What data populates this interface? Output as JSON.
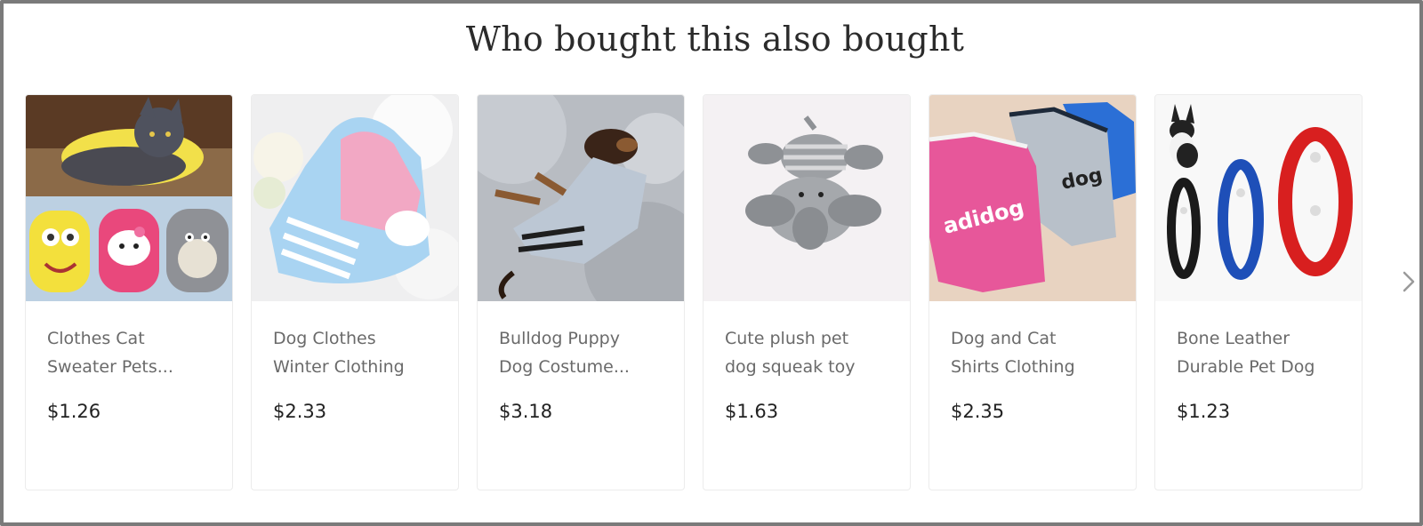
{
  "section": {
    "title": "Who bought this also bought"
  },
  "products": [
    {
      "name_line1": "Clothes Cat",
      "name_line2": "Sweater Pets...",
      "price": "$1.26",
      "image": "cat-sweater-photo"
    },
    {
      "name_line1": "Dog Clothes",
      "name_line2": "Winter Clothing",
      "price": "$2.33",
      "image": "pink-blue-hoodie-photo"
    },
    {
      "name_line1": "Bulldog Puppy",
      "name_line2": "Dog Costume...",
      "price": "$3.18",
      "image": "puppy-tracksuit-photo"
    },
    {
      "name_line1": "Cute plush pet",
      "name_line2": "dog squeak toy",
      "price": "$1.63",
      "image": "elephant-plush-toy-photo"
    },
    {
      "name_line1": "Dog and Cat",
      "name_line2": "Shirts Clothing",
      "price": "$2.35",
      "image": "adidog-shirts-photo"
    },
    {
      "name_line1": "Bone Leather",
      "name_line2": "Durable Pet Dog",
      "price": "$1.23",
      "image": "bone-leather-collars-photo"
    }
  ],
  "controls": {
    "next_icon": "chevron-right-icon"
  },
  "colors": {
    "frame_border": "#7a7a7a",
    "title": "#2b2b2b",
    "product_name": "#6a6a6a",
    "price": "#222222"
  }
}
